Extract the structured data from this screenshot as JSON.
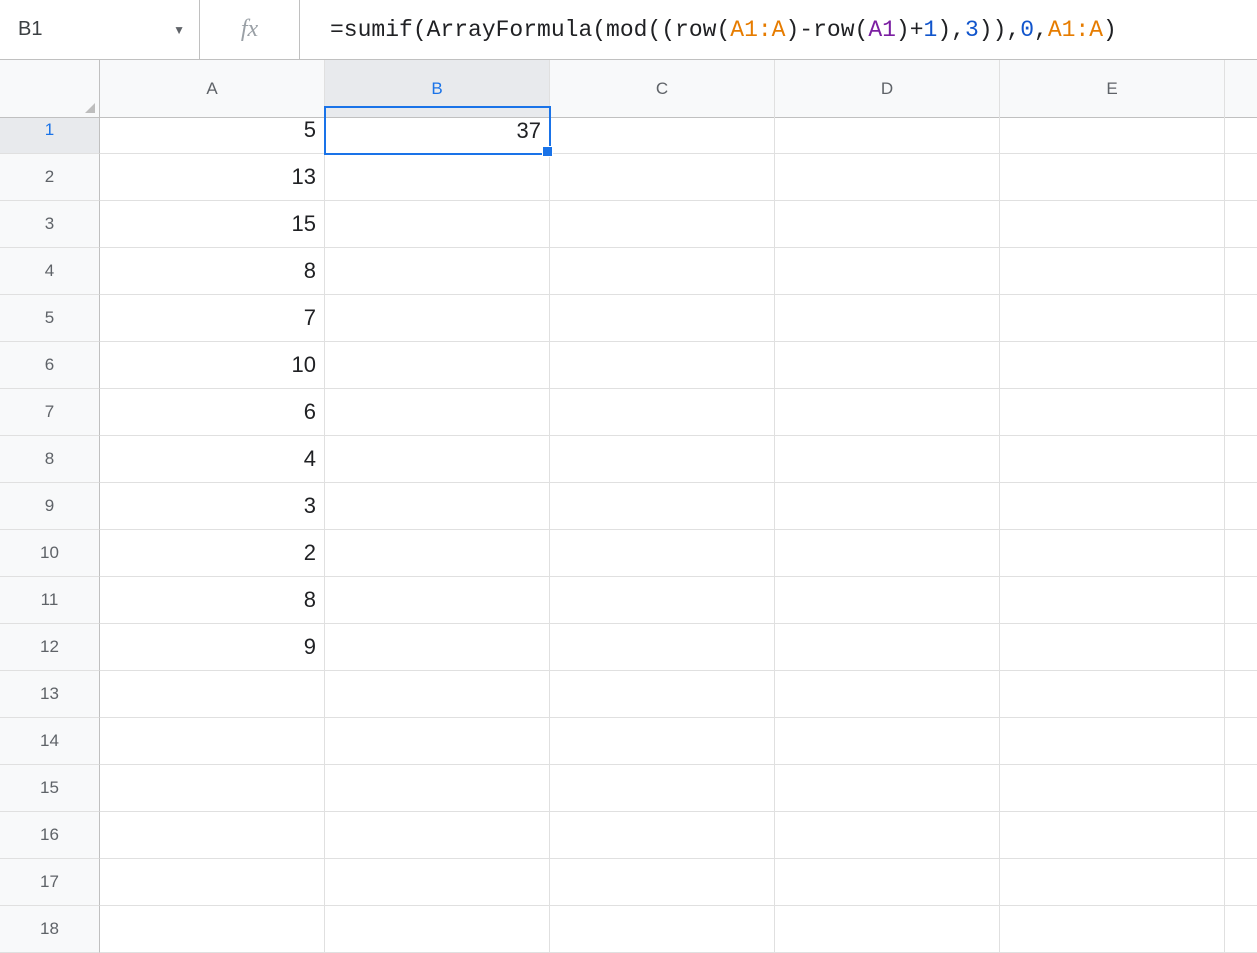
{
  "nameBox": "B1",
  "fxLabel": "fx",
  "formula": {
    "tokens": [
      {
        "t": "=sumif(ArrayFormula(mod((row(",
        "c": "black"
      },
      {
        "t": "A1:A",
        "c": "orange"
      },
      {
        "t": ")-row(",
        "c": "black"
      },
      {
        "t": "A1",
        "c": "purple"
      },
      {
        "t": ")+",
        "c": "black"
      },
      {
        "t": "1",
        "c": "blue"
      },
      {
        "t": "),",
        "c": "black"
      },
      {
        "t": "3",
        "c": "blue"
      },
      {
        "t": ")),",
        "c": "black"
      },
      {
        "t": "0",
        "c": "blue"
      },
      {
        "t": ",",
        "c": "black"
      },
      {
        "t": "A1:A",
        "c": "orange"
      },
      {
        "t": ")",
        "c": "black"
      }
    ]
  },
  "columns": [
    "A",
    "B",
    "C",
    "D",
    "E"
  ],
  "rowCount": 18,
  "selectedCell": {
    "row": 1,
    "col": "B"
  },
  "cells": {
    "A1": "5",
    "A2": "13",
    "A3": "15",
    "A4": "8",
    "A5": "7",
    "A6": "10",
    "A7": "6",
    "A8": "4",
    "A9": "3",
    "A10": "2",
    "A11": "8",
    "A12": "9",
    "B1": "37"
  }
}
